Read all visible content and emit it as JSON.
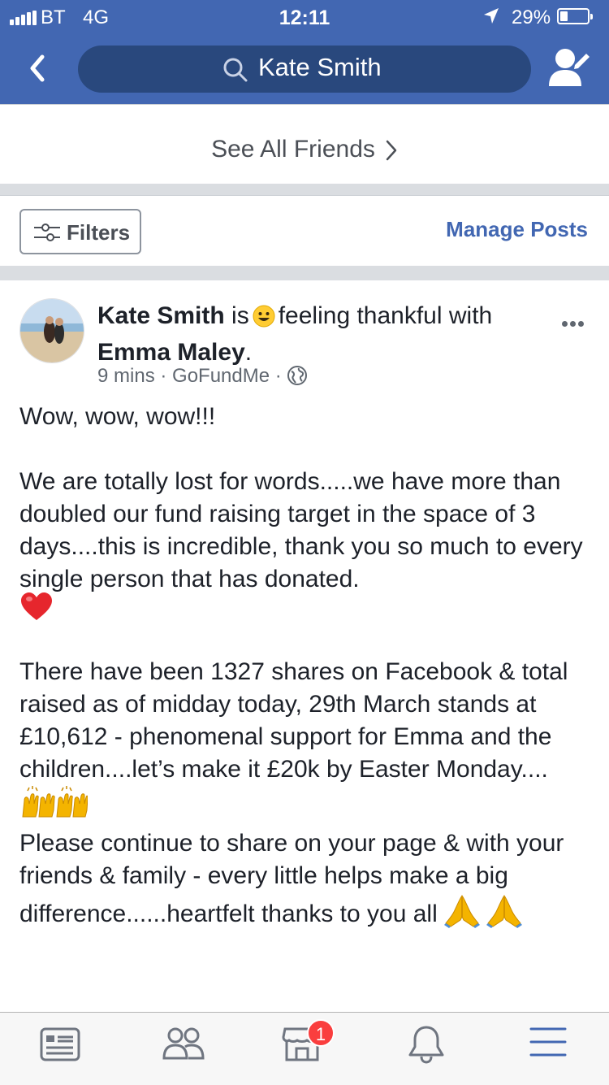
{
  "status_bar": {
    "carrier": "BT",
    "network": "4G",
    "time": "12:11",
    "battery_percent": "29%",
    "battery_level": 0.29
  },
  "nav": {
    "search_value": "Kate Smith",
    "back_icon": "chevron-left-icon",
    "search_icon": "search-icon",
    "profile_icon": "edit-profile-icon"
  },
  "friends": {
    "see_all_label": "See All Friends"
  },
  "filters": {
    "filters_label": "Filters",
    "manage_posts_label": "Manage Posts"
  },
  "post": {
    "author": "Kate Smith",
    "verb": "is",
    "feeling": "feeling thankful with",
    "tagged": "Emma Maley",
    "tagged_suffix": ".",
    "time": "9 mins",
    "source": "GoFundMe",
    "separator": "·",
    "privacy_icon": "globe-icon",
    "lines": {
      "p1": "Wow, wow, wow!!!",
      "p2": "We are totally lost for words.....we have more than doubled our fund raising target in the space of 3 days....this is incredible, thank you so much to every single person that has donated.",
      "p3": "There have been 1327 shares on Facebook & total raised as of midday today, 29th March stands at £10,612 - phenomenal support for Emma and the children....let’s make it £20k by Easter Monday....",
      "p4": "Please continue to share on your page & with your friends & family - every little helps make a big difference......heartfelt thanks to you all"
    }
  },
  "tabbar": {
    "items": [
      {
        "name": "news-feed",
        "icon": "news-feed-icon"
      },
      {
        "name": "friends",
        "icon": "friends-icon"
      },
      {
        "name": "marketplace",
        "icon": "marketplace-icon"
      },
      {
        "name": "notifications",
        "icon": "bell-icon"
      },
      {
        "name": "menu",
        "icon": "menu-icon"
      }
    ],
    "marketplace_badge": "1"
  },
  "colors": {
    "brand_blue": "#4267b2",
    "search_bg": "#29487d",
    "link_blue": "#4267b2",
    "badge_red": "#fa3e3e"
  }
}
